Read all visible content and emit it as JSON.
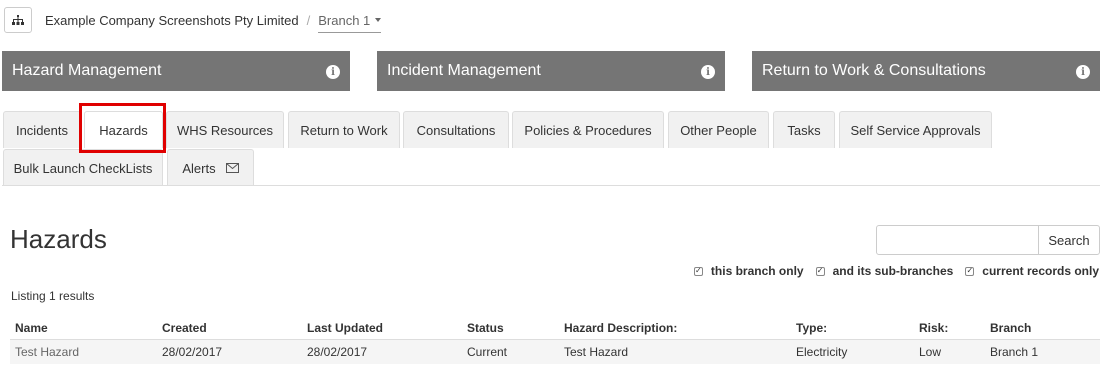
{
  "topbar": {
    "org_icon": "sitemap-icon",
    "company": "Example Company Screenshots Pty Limited",
    "separator": "/",
    "branch": "Branch 1"
  },
  "modules": [
    {
      "label": "Hazard Management",
      "icon": "info-icon"
    },
    {
      "label": "Incident Management",
      "icon": "info-icon"
    },
    {
      "label": "Return to Work & Consultations",
      "icon": "info-icon"
    }
  ],
  "tabs": [
    {
      "label": "Incidents"
    },
    {
      "label": "Hazards",
      "active": true
    },
    {
      "label": "WHS Resources"
    },
    {
      "label": "Return to Work"
    },
    {
      "label": "Consultations"
    },
    {
      "label": "Policies & Procedures"
    },
    {
      "label": "Other People"
    },
    {
      "label": "Tasks"
    },
    {
      "label": "Self Service Approvals"
    },
    {
      "label": "Bulk Launch CheckLists"
    },
    {
      "label": "Alerts",
      "icon": "envelope-icon"
    }
  ],
  "page": {
    "title": "Hazards",
    "search_value": "",
    "search_button": "Search",
    "filters": [
      {
        "label": "this branch only",
        "checked": true
      },
      {
        "label": "and its sub-branches",
        "checked": true
      },
      {
        "label": "current records only",
        "checked": true
      }
    ],
    "listing": "Listing 1 results"
  },
  "table": {
    "columns": [
      "Name",
      "Created",
      "Last Updated",
      "Status",
      "Hazard Description:",
      "Type:",
      "Risk:",
      "Branch"
    ],
    "rows": [
      [
        "Test Hazard",
        "28/02/2017",
        "28/02/2017",
        "Current",
        "Test Hazard",
        "Electricity",
        "Low",
        "Branch 1"
      ]
    ]
  },
  "colors": {
    "module_bar": "#757575",
    "highlight": "#e00000",
    "tab_bg": "#f1f1f1"
  }
}
